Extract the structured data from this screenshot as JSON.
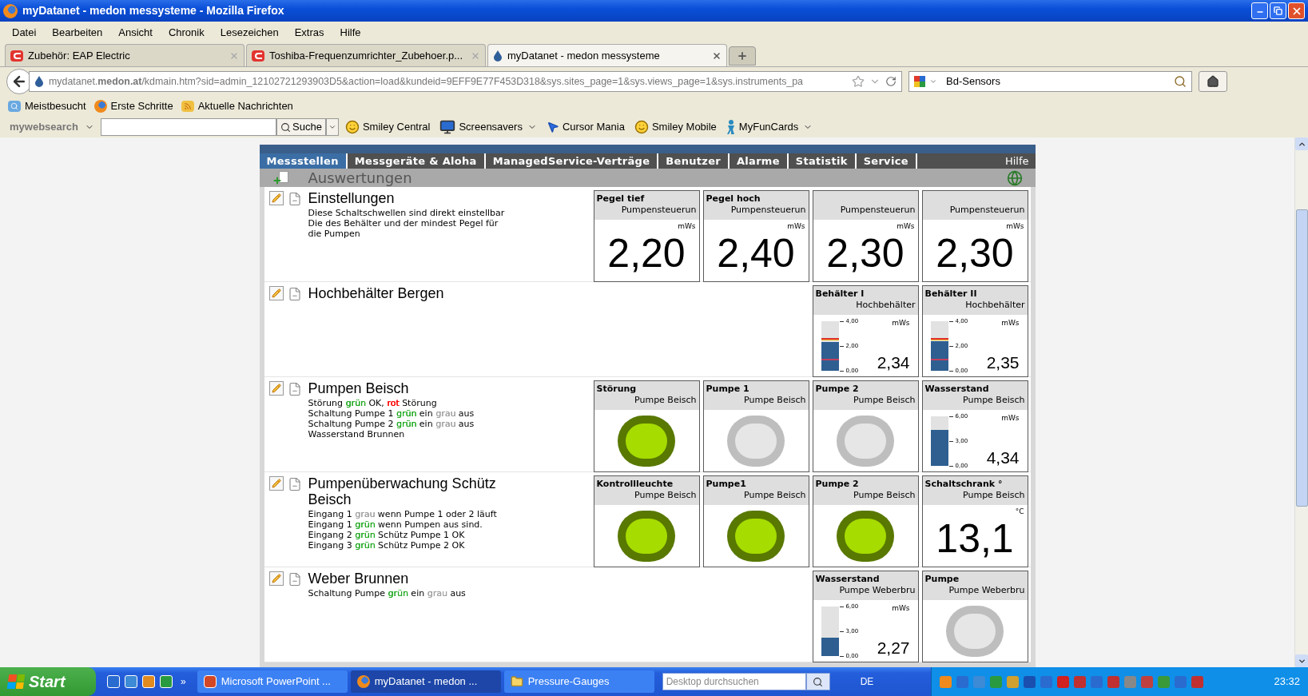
{
  "window": {
    "title": "myDatanet - medon messysteme - Mozilla Firefox"
  },
  "menu": [
    "Datei",
    "Bearbeiten",
    "Ansicht",
    "Chronik",
    "Lesezeichen",
    "Extras",
    "Hilfe"
  ],
  "tabs": [
    {
      "label": "Zubehör: EAP Electric",
      "kind": "eap",
      "selected": false
    },
    {
      "label": "Toshiba-Frequenzumrichter_Zubehoer.p...",
      "kind": "eap",
      "selected": false
    },
    {
      "label": "myDatanet - medon messysteme",
      "kind": "drop",
      "selected": true
    }
  ],
  "address": {
    "url": "mydatanet.**medon.at**/kdmain.htm?sid=admin_12102721293903D5&action=load&kundeid=9EFF9E77F453D318&sys.sites_page=1&sys.views_page=1&sys.instruments_pa"
  },
  "web_search": {
    "value": "Bd-Sensors"
  },
  "bookmarks": [
    {
      "label": "Meistbesucht",
      "kind": "search"
    },
    {
      "label": "Erste Schritte",
      "kind": "firefox"
    },
    {
      "label": "Aktuelle Nachrichten",
      "kind": "rss"
    }
  ],
  "toolbar": {
    "logo": "my**web**search",
    "search_button": "Suche",
    "items": [
      {
        "label": "Smiley Central",
        "kind": "smiley",
        "dropdown": false
      },
      {
        "label": "Screensavers",
        "kind": "monitor",
        "dropdown": true
      },
      {
        "label": "Cursor Mania",
        "kind": "cursor",
        "dropdown": false
      },
      {
        "label": "Smiley Mobile",
        "kind": "smiley",
        "dropdown": false
      },
      {
        "label": "MyFunCards",
        "kind": "card",
        "dropdown": true
      }
    ]
  },
  "site_nav": {
    "items": [
      {
        "label": "Messstellen",
        "selected": true
      },
      {
        "label": "Messgeräte & Aloha",
        "selected": false
      },
      {
        "label": "ManagedService-Verträge",
        "selected": false
      },
      {
        "label": "Benutzer",
        "selected": false
      },
      {
        "label": "Alarme",
        "selected": false
      },
      {
        "label": "Statistik",
        "selected": false
      },
      {
        "label": "Service",
        "selected": false
      }
    ],
    "help": "Hilfe"
  },
  "subheader": "Auswertungen",
  "sections": [
    {
      "title": "Einstellungen",
      "lines": [
        [
          {
            "text": "Diese Schaltschwellen sind direkt einstellbar"
          }
        ],
        [
          {
            "text": "Die des Behälter und der mindest Pegel für"
          }
        ],
        [
          {
            "text": "die Pumpen"
          }
        ]
      ],
      "widgets": [
        {
          "kind": "value",
          "title": "Pegel tief",
          "subtitle": "Pumpensteuerun",
          "unit": "mWs",
          "value": "2,20"
        },
        {
          "kind": "value",
          "title": "Pegel hoch",
          "subtitle": "Pumpensteuerun",
          "unit": "mWs",
          "value": "2,40"
        },
        {
          "kind": "value",
          "subtitle": "Pumpensteuerun",
          "unit": "mWs",
          "value": "2,30"
        },
        {
          "kind": "value",
          "subtitle": "Pumpensteuerun",
          "unit": "mWs",
          "value": "2,30"
        }
      ]
    },
    {
      "title": "Hochbehälter Bergen",
      "widgets": [
        {
          "kind": "gauge",
          "title": "Behälter I",
          "subtitle": "Hochbehälter",
          "unit": "mWs",
          "ticks": [
            "4,00",
            "2,00",
            "0,00"
          ],
          "value": "2,34",
          "level": 0.585,
          "threshold_marks": true
        },
        {
          "kind": "gauge",
          "title": "Behälter II",
          "subtitle": "Hochbehälter",
          "unit": "mWs",
          "ticks": [
            "4,00",
            "2,00",
            "0,00"
          ],
          "value": "2,35",
          "level": 0.59,
          "threshold_marks": true
        }
      ]
    },
    {
      "title": "Pumpen Beisch",
      "lines": [
        [
          {
            "text": "Störung "
          },
          {
            "text": "grün",
            "color": "#1fa81f"
          },
          {
            "text": " OK, "
          },
          {
            "text": "rot",
            "color": "#ff0000"
          },
          {
            "text": " Störung"
          }
        ],
        [
          {
            "text": "Schaltung Pumpe 1 "
          },
          {
            "text": "grün",
            "color": "#1fa81f"
          },
          {
            "text": " ein "
          },
          {
            "text": "grau",
            "color": "#a0a0a0"
          },
          {
            "text": " aus"
          }
        ],
        [
          {
            "text": "Schaltung Pumpe 2 "
          },
          {
            "text": "grün",
            "color": "#1fa81f"
          },
          {
            "text": " ein "
          },
          {
            "text": "grau",
            "color": "#a0a0a0"
          },
          {
            "text": " aus"
          }
        ],
        [
          {
            "text": "Wasserstand Brunnen"
          }
        ]
      ],
      "widgets": [
        {
          "kind": "lamp",
          "title": "Störung",
          "subtitle": "Pumpe Beisch",
          "on": true
        },
        {
          "kind": "lamp",
          "title": "Pumpe 1",
          "subtitle": "Pumpe Beisch",
          "on": false
        },
        {
          "kind": "lamp",
          "title": "Pumpe 2",
          "subtitle": "Pumpe Beisch",
          "on": false
        },
        {
          "kind": "gauge",
          "title": "Wasserstand",
          "subtitle": "Pumpe Beisch",
          "unit": "mWs",
          "ticks": [
            "6,00",
            "3,00",
            "0,00"
          ],
          "value": "4,34",
          "level": 0.72,
          "threshold_marks": false
        }
      ]
    },
    {
      "title": "Pumpenüberwachung Schütz Beisch",
      "lines": [
        [
          {
            "text": "Eingang 1 "
          },
          {
            "text": "grau",
            "color": "#a0a0a0"
          },
          {
            "text": " wenn Pumpe 1 oder 2 läuft"
          }
        ],
        [
          {
            "text": "Eingang 1 "
          },
          {
            "text": "grün",
            "color": "#1fa81f"
          },
          {
            "text": " wenn Pumpen aus sind."
          }
        ],
        [
          {
            "text": "Eingang 2 "
          },
          {
            "text": "grün",
            "color": "#1fa81f"
          },
          {
            "text": " Schütz Pumpe 1 OK"
          }
        ],
        [
          {
            "text": "Eingang 3 "
          },
          {
            "text": "grün",
            "color": "#1fa81f"
          },
          {
            "text": " Schütz Pumpe 2 OK"
          }
        ]
      ],
      "widgets": [
        {
          "kind": "lamp",
          "title": "Kontrollleuchte",
          "subtitle": "Pumpe Beisch",
          "on": true
        },
        {
          "kind": "lamp",
          "title": "Pumpe1",
          "subtitle": "Pumpe Beisch",
          "on": true
        },
        {
          "kind": "lamp",
          "title": "Pumpe 2",
          "subtitle": "Pumpe Beisch",
          "on": true
        },
        {
          "kind": "value",
          "title": "Schaltschrank °",
          "subtitle": "Pumpe Beisch",
          "unit": "°C",
          "value": "13,1"
        }
      ]
    },
    {
      "title": "Weber Brunnen",
      "lines": [
        [
          {
            "text": "Schaltung Pumpe "
          },
          {
            "text": "grün",
            "color": "#1fa81f"
          },
          {
            "text": " ein "
          },
          {
            "text": "grau",
            "color": "#a0a0a0"
          },
          {
            "text": " aus"
          }
        ]
      ],
      "widgets": [
        {
          "kind": "gauge",
          "title": "Wasserstand",
          "subtitle": "Pumpe Weberbru",
          "unit": "mWs",
          "ticks": [
            "6,00",
            "3,00",
            "0,00"
          ],
          "value": "2,27",
          "level": 0.37,
          "threshold_marks": false
        },
        {
          "kind": "lamp",
          "title": "Pumpe",
          "subtitle": "Pumpe Weberbru",
          "on": false
        }
      ]
    }
  ],
  "taskbar": {
    "start": "Start",
    "more": "»",
    "tasks": [
      {
        "label": "Microsoft PowerPoint ...",
        "kind": "powerpoint",
        "selected": false
      },
      {
        "label": "myDatanet - medon ...",
        "kind": "firefox",
        "selected": true
      },
      {
        "label": "Pressure-Gauges",
        "kind": "folder",
        "selected": false
      }
    ],
    "search": {
      "placeholder": "Desktop durchsuchen"
    },
    "language": "DE",
    "clock": "23:32"
  }
}
